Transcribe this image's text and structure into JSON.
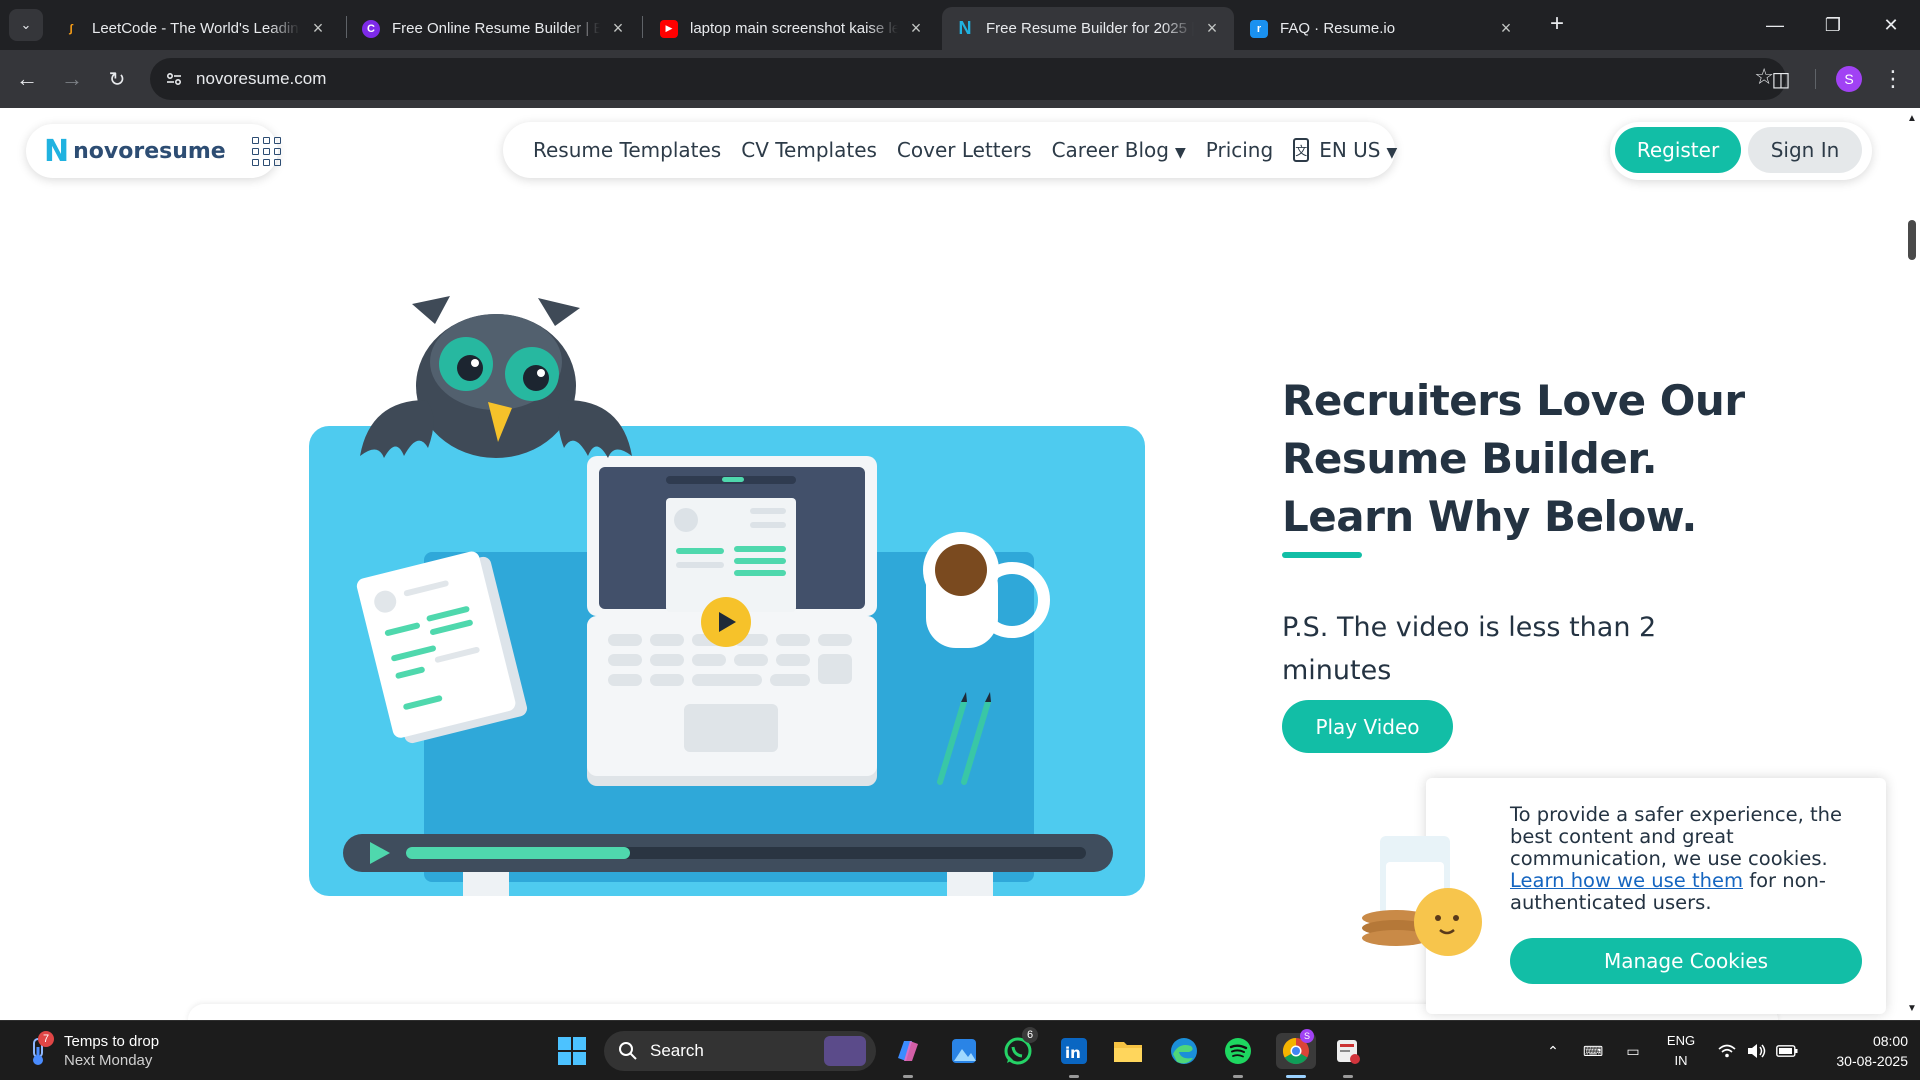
{
  "browser": {
    "tabs": [
      {
        "title": "LeetCode - The World's Leading",
        "favicon": "leetcode-icon",
        "active": false
      },
      {
        "title": "Free Online Resume Builder | Ea",
        "favicon": "canva-icon",
        "active": false
      },
      {
        "title": "laptop main screenshot kaise le",
        "favicon": "youtube-icon",
        "active": false
      },
      {
        "title": "Free Resume Builder for 2025 | ",
        "favicon": "novoresume-icon",
        "active": true
      },
      {
        "title": "FAQ · Resume.io",
        "favicon": "resumeio-icon",
        "active": false
      }
    ],
    "url": "novoresume.com",
    "profile_initial": "S"
  },
  "site": {
    "logo_text": "novoresume",
    "nav": {
      "resume_templates": "Resume Templates",
      "cv_templates": "CV Templates",
      "cover_letters": "Cover Letters",
      "career_blog": "Career Blog",
      "pricing": "Pricing",
      "language": "EN US"
    },
    "register_label": "Register",
    "signin_label": "Sign In",
    "hero": {
      "title_line1": "Recruiters Love Our",
      "title_line2": "Resume Builder.",
      "title_line3": "Learn Why Below.",
      "subtitle": "P.S. The video is less than 2 minutes",
      "play_label": "Play Video",
      "video_progress": 0.33
    },
    "cookie": {
      "text_before": "To provide a safer experience, the best content and great communication, we use cookies.",
      "link_text": "Learn how we use them",
      "text_after": "for non-authenticated users.",
      "button_label": "Manage Cookies"
    }
  },
  "taskbar": {
    "weather_badge": "7",
    "weather_line1": "Temps to drop",
    "weather_line2": "Next Monday",
    "search_label": "Search",
    "whatsapp_badge": "6",
    "lang_line1": "ENG",
    "lang_line2": "IN",
    "time": "08:00",
    "date": "30-08-2025"
  },
  "colors": {
    "accent": "#12bea6",
    "hero_bg": "#4ecbef",
    "title_text": "#243342"
  }
}
